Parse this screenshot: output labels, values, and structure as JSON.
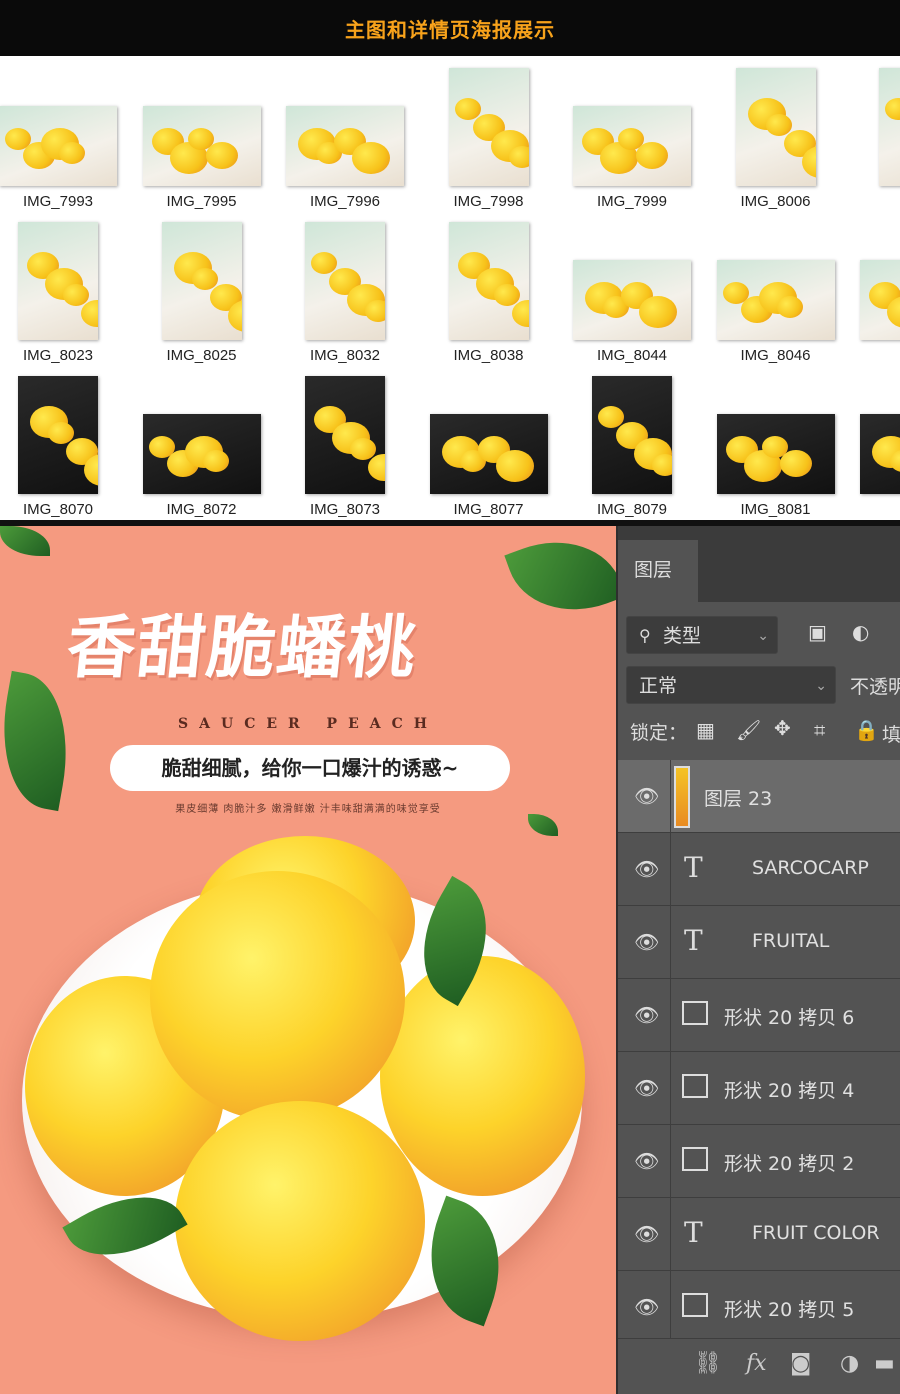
{
  "banner": {
    "title": "主图和详情页海报展示"
  },
  "thumbnails": [
    {
      "label": "IMG_7993",
      "orientation": "landscape",
      "theme": "light"
    },
    {
      "label": "IMG_7995",
      "orientation": "landscape",
      "theme": "light"
    },
    {
      "label": "IMG_7996",
      "orientation": "landscape",
      "theme": "light"
    },
    {
      "label": "IMG_7998",
      "orientation": "portrait",
      "theme": "light"
    },
    {
      "label": "IMG_7999",
      "orientation": "landscape",
      "theme": "light"
    },
    {
      "label": "IMG_8006",
      "orientation": "portrait",
      "theme": "light"
    },
    {
      "label": "IM",
      "orientation": "portrait",
      "theme": "light"
    },
    {
      "label": "IMG_8023",
      "orientation": "portrait",
      "theme": "light"
    },
    {
      "label": "IMG_8025",
      "orientation": "portrait",
      "theme": "light"
    },
    {
      "label": "IMG_8032",
      "orientation": "portrait",
      "theme": "light"
    },
    {
      "label": "IMG_8038",
      "orientation": "portrait",
      "theme": "light"
    },
    {
      "label": "IMG_8044",
      "orientation": "landscape",
      "theme": "light"
    },
    {
      "label": "IMG_8046",
      "orientation": "landscape",
      "theme": "light"
    },
    {
      "label": "IM",
      "orientation": "landscape",
      "theme": "light"
    },
    {
      "label": "IMG_8070",
      "orientation": "portrait",
      "theme": "dark"
    },
    {
      "label": "IMG_8072",
      "orientation": "landscape",
      "theme": "dark"
    },
    {
      "label": "IMG_8073",
      "orientation": "portrait",
      "theme": "dark"
    },
    {
      "label": "IMG_8077",
      "orientation": "landscape",
      "theme": "dark"
    },
    {
      "label": "IMG_8079",
      "orientation": "portrait",
      "theme": "dark"
    },
    {
      "label": "IMG_8081",
      "orientation": "landscape",
      "theme": "dark"
    },
    {
      "label": "IM",
      "orientation": "landscape",
      "theme": "dark"
    }
  ],
  "poster": {
    "title": "香甜脆蟠桃",
    "subtitle_en": "SAUCER PEACH",
    "slogan": "脆甜细腻，给你一口爆汁的诱惑~",
    "small_text": "果皮细薄  肉脆汁多  嫩滑鲜嫩  汁丰味甜满满的味觉享受",
    "background_color": "#f59a80"
  },
  "layers_panel": {
    "tab": "图层",
    "filter_label": "类型",
    "blend_mode": "正常",
    "opacity_label": "不透明",
    "lock_label": "锁定：",
    "fill_label_partial": "填",
    "layers": [
      {
        "name": "图层 23",
        "type": "image",
        "selected": true
      },
      {
        "name": "SARCOCARP",
        "type": "text"
      },
      {
        "name": "FRUITAL",
        "type": "text"
      },
      {
        "name": "形状 20 拷贝 6",
        "type": "shape"
      },
      {
        "name": "形状 20 拷贝 4",
        "type": "shape"
      },
      {
        "name": "形状 20 拷贝 2",
        "type": "shape"
      },
      {
        "name": "FRUIT COLOR",
        "type": "text"
      },
      {
        "name": "形状 20 拷贝 5",
        "type": "shape"
      }
    ]
  }
}
